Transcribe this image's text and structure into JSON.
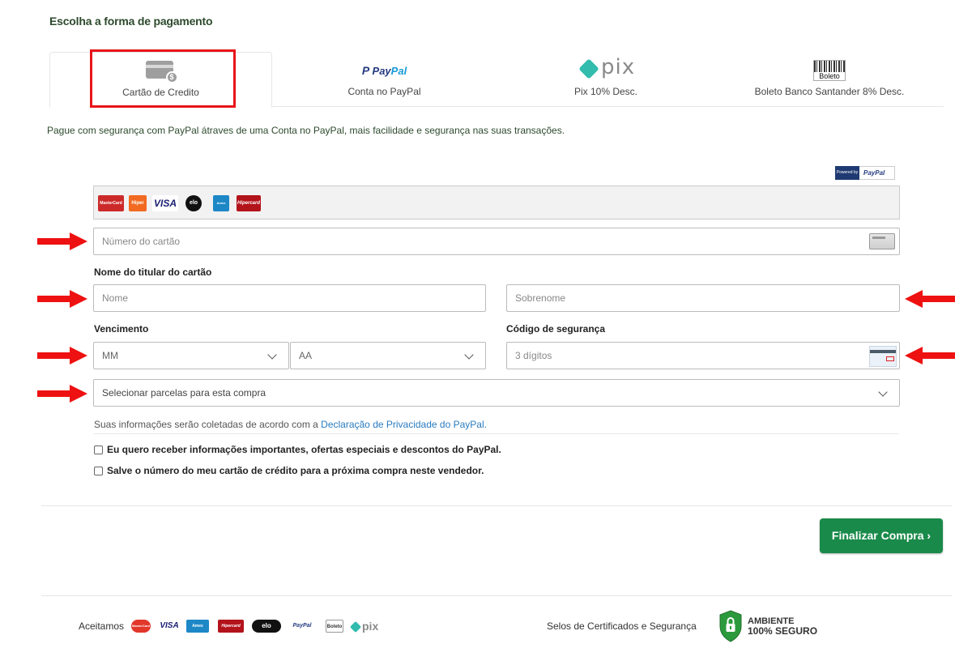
{
  "header": {
    "title": "Escolha a forma de pagamento"
  },
  "tabs": [
    {
      "label": "Cartão de Credito",
      "icon": "credit-card-icon"
    },
    {
      "label": "Conta no PayPal",
      "icon": "paypal-logo",
      "logo_p1": "Pay",
      "logo_p2": "Pal"
    },
    {
      "label": "Pix 10% Desc.",
      "icon": "pix-logo",
      "logo_text": "pix"
    },
    {
      "label": "Boleto Banco Santander 8% Desc.",
      "icon": "boleto-barcode-icon",
      "logo_text": "Boleto"
    }
  ],
  "info_text": "Pague com segurança com PayPal átraves de uma Conta no PayPal, mais facilidade e segurança nas suas transações.",
  "powered_by": {
    "prefix": "Powered by",
    "brand": "PayPal"
  },
  "card_brands": [
    "MasterCard",
    "Hiper",
    "VISA",
    "elo",
    "Amex",
    "Hipercard"
  ],
  "form": {
    "card_number_placeholder": "Número do cartão",
    "holder_label": "Nome do titular do cartão",
    "first_name_placeholder": "Nome",
    "last_name_placeholder": "Sobrenome",
    "expiry_label": "Vencimento",
    "month_value": "MM",
    "year_value": "AA",
    "cvv_label": "Código de segurança",
    "cvv_placeholder": "3 dígitos",
    "installments_value": "Selecionar parcelas para esta compra"
  },
  "privacy": {
    "text": "Suas informações serão coletadas de acordo com a ",
    "link": "Declaração de Privacidade do PayPal."
  },
  "checkboxes": [
    {
      "label": "Eu quero receber informações importantes, ofertas especiais e descontos do PayPal.",
      "checked": false
    },
    {
      "label": "Salve o número do meu cartão de crédito para a próxima compra neste vendedor.",
      "checked": false
    }
  ],
  "finish_button": "Finalizar Compra ›",
  "footer": {
    "accept_label": "Aceitamos",
    "brands": [
      "MasterCard",
      "VISA",
      "Amex",
      "Hipercard",
      "elo",
      "PayPal",
      "Boleto",
      "pix"
    ],
    "seals_label": "Selos de Certificados e Segurança",
    "secure_line1": "AMBIENTE",
    "secure_line2": "100% SEGURO"
  },
  "colors": {
    "accent_green": "#1a8a4a",
    "highlight_red": "#e8141a",
    "link_blue": "#2a7bbf",
    "title_green": "#2d4a2d"
  }
}
